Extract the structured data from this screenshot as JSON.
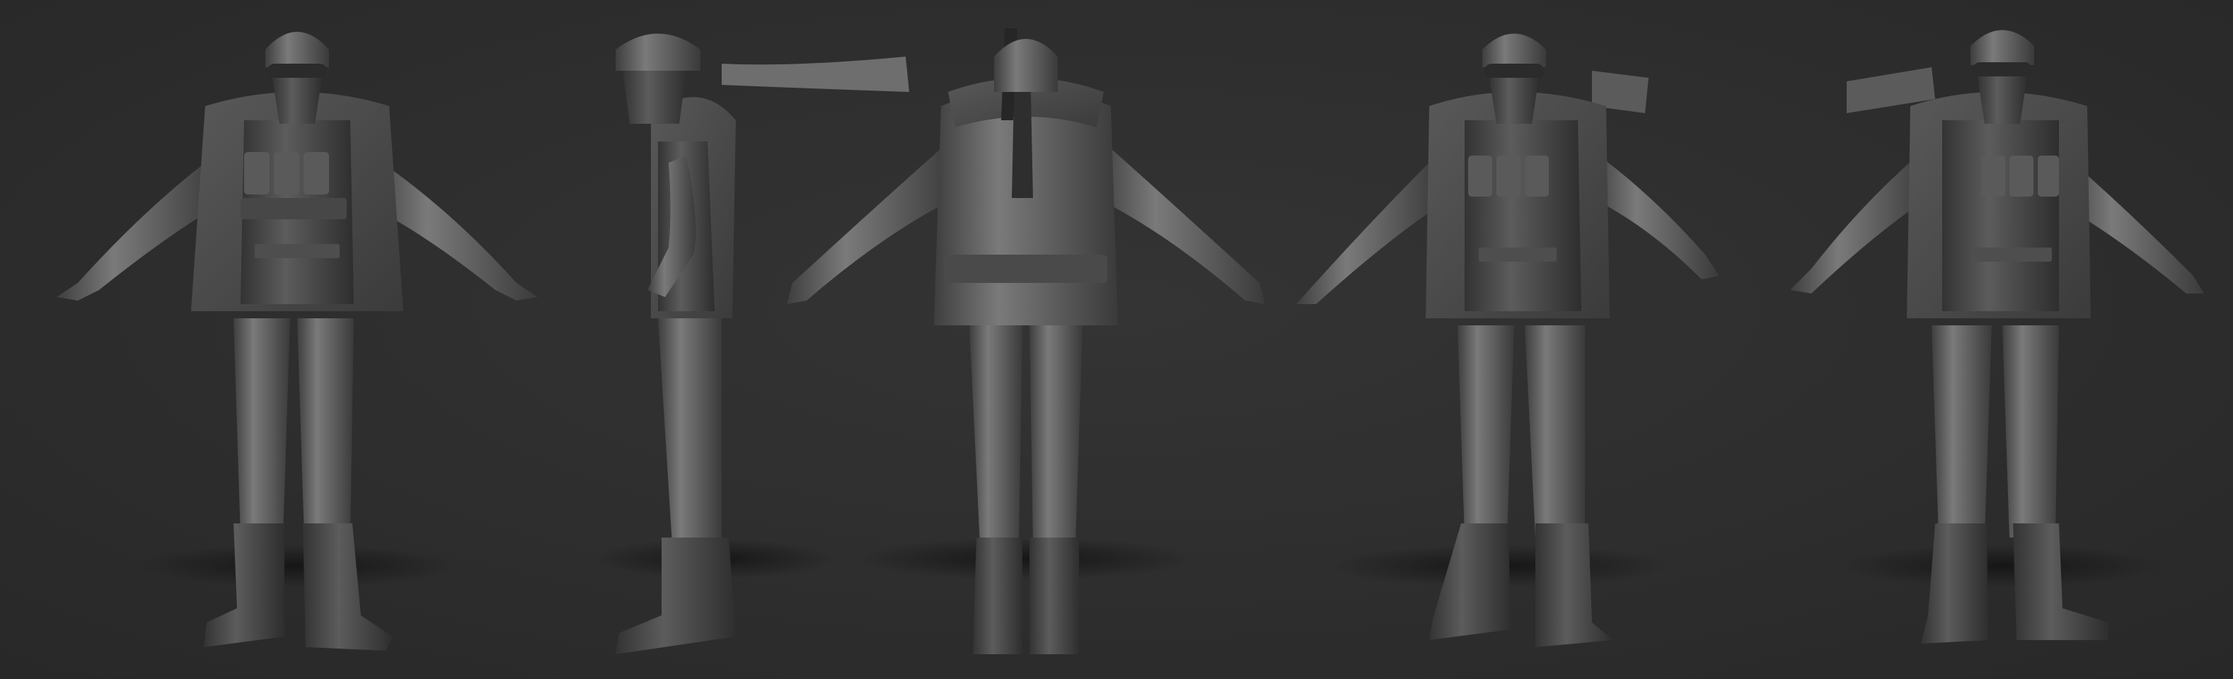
{
  "scene": {
    "background_color": "#2f2f2f",
    "material_color": "#6b6b6b",
    "shadow_color": "#151515",
    "views": [
      {
        "id": "front",
        "icon": "character-front-view"
      },
      {
        "id": "side",
        "icon": "character-side-view"
      },
      {
        "id": "back",
        "icon": "character-back-view"
      },
      {
        "id": "three-quarter-left",
        "icon": "character-three-quarter-view"
      },
      {
        "id": "three-quarter-right",
        "icon": "character-three-quarter-view"
      }
    ]
  }
}
